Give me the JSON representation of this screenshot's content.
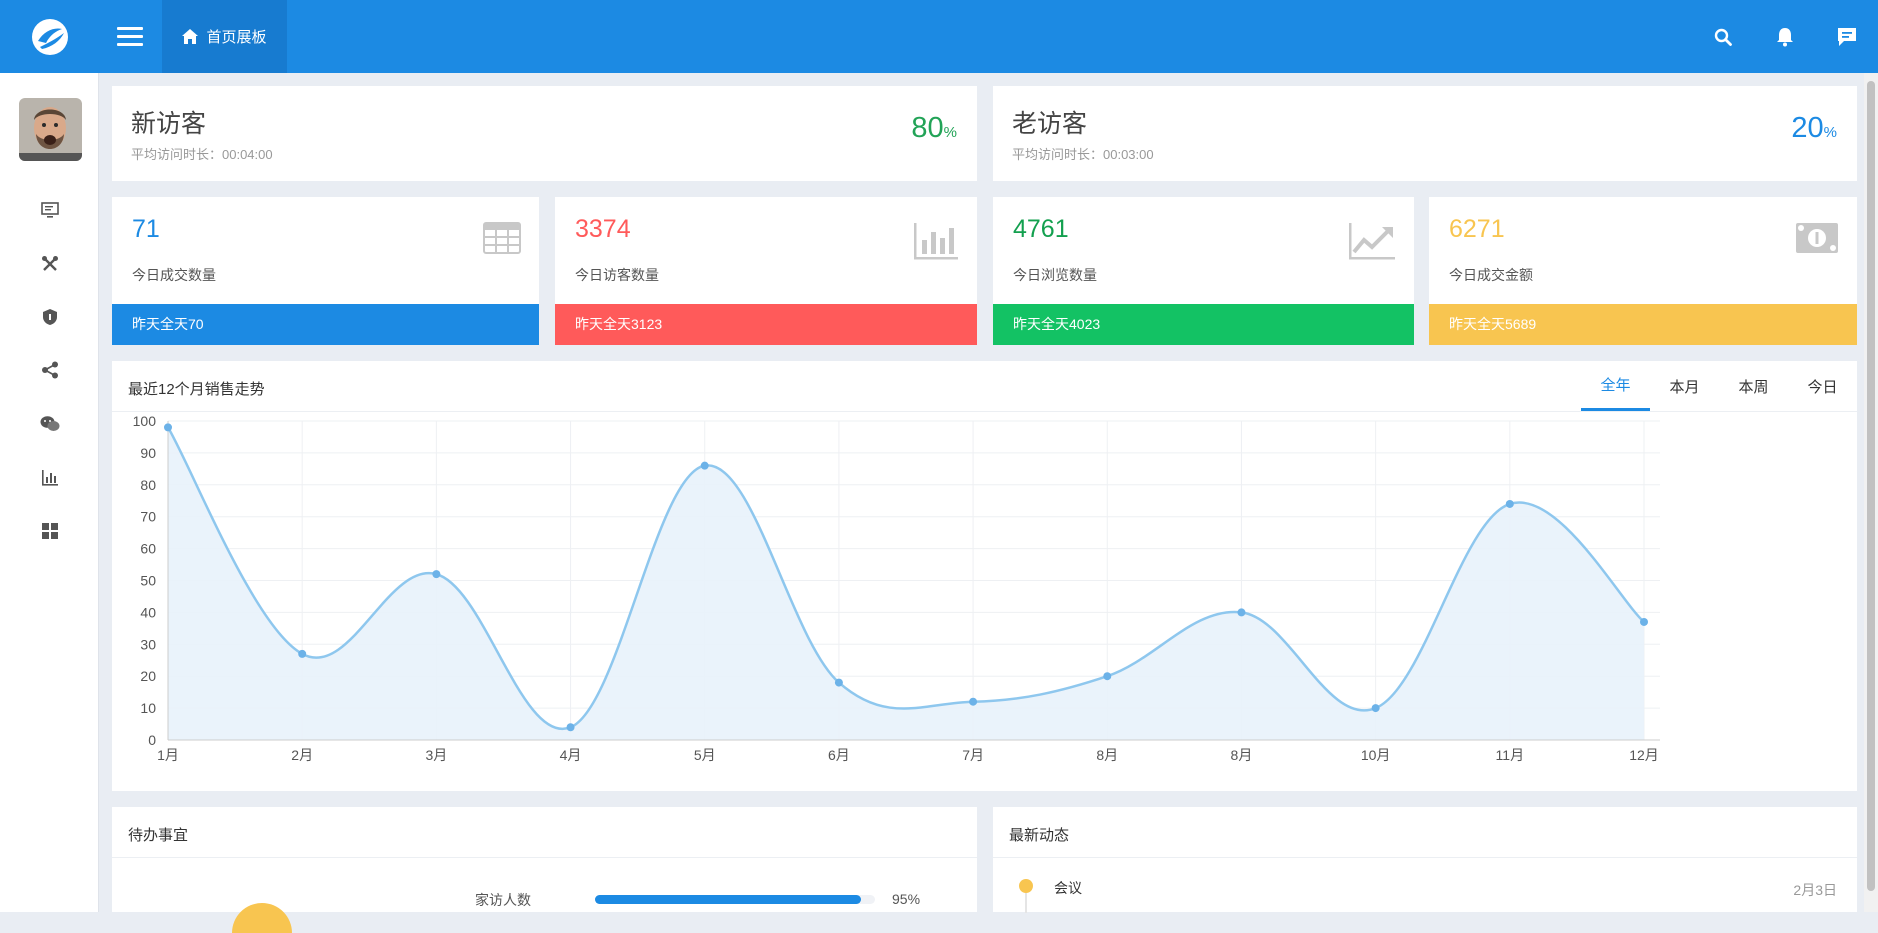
{
  "header": {
    "home_tab_label": "首页展板"
  },
  "visitors": [
    {
      "title": "新访客",
      "subtitle": "平均访问时长：00:04:00",
      "percent": "80",
      "unit": "%",
      "color": "#22a357"
    },
    {
      "title": "老访客",
      "subtitle": "平均访问时长：00:03:00",
      "percent": "20",
      "unit": "%",
      "color": "#1c8ae3"
    }
  ],
  "stats": [
    {
      "value": "71",
      "label": "今日成交数量",
      "footer": "昨天全天70",
      "color": "#1c8ae3",
      "icon": "table-icon"
    },
    {
      "value": "3374",
      "label": "今日访客数量",
      "footer": "昨天全天3123",
      "color": "#ff5a5a",
      "icon": "bar-chart-icon"
    },
    {
      "value": "4761",
      "label": "今日浏览数量",
      "footer": "昨天全天4023",
      "color": "#13c264",
      "icon": "trend-up-icon"
    },
    {
      "value": "6271",
      "label": "今日成交金额",
      "footer": "昨天全天5689",
      "color": "#f8c550",
      "icon": "money-icon"
    }
  ],
  "sales_panel": {
    "title": "最近12个月销售走势",
    "tabs": [
      "全年",
      "本月",
      "本周",
      "今日"
    ],
    "active_tab": 0
  },
  "chart_data": {
    "type": "area",
    "categories": [
      "1月",
      "2月",
      "3月",
      "4月",
      "5月",
      "6月",
      "7月",
      "8月",
      "8月",
      "10月",
      "11月",
      "12月"
    ],
    "values": [
      98,
      27,
      52,
      4,
      86,
      18,
      12,
      20,
      40,
      10,
      74,
      37
    ],
    "ylim": [
      0,
      100
    ],
    "yticks": [
      0,
      10,
      20,
      30,
      40,
      50,
      60,
      70,
      80,
      90,
      100
    ],
    "grid": true,
    "line_color": "#8ec7ee",
    "fill_color": "#e8f2fb"
  },
  "todo_panel": {
    "title": "待办事宜",
    "items": [
      {
        "label": "家访人数",
        "percent": 95,
        "percent_text": "95%"
      }
    ]
  },
  "news_panel": {
    "title": "最新动态",
    "items": [
      {
        "title": "会议",
        "date": "2月3日"
      }
    ]
  }
}
